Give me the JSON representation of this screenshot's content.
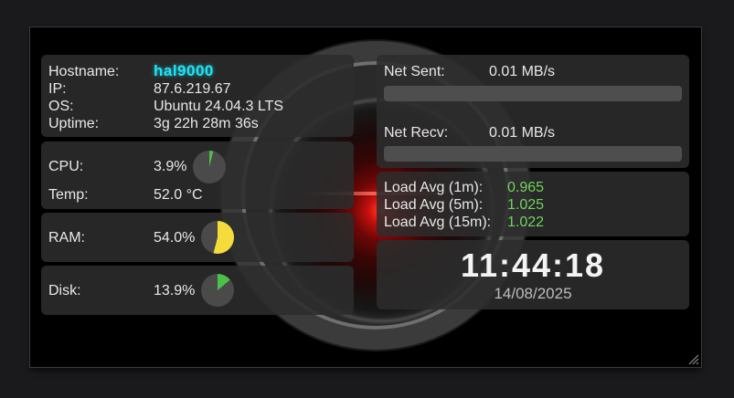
{
  "system": {
    "hostname_label": "Hostname:",
    "hostname": "hal9000",
    "ip_label": "IP:",
    "ip": "87.6.219.67",
    "os_label": "OS:",
    "os": "Ubuntu 24.04.3 LTS",
    "uptime_label": "Uptime:",
    "uptime": "3g 22h 28m 36s"
  },
  "cpu": {
    "label": "CPU:",
    "value": "3.9%",
    "percent": 3.9,
    "color": "#4cc048"
  },
  "temp": {
    "label": "Temp:",
    "value": "52.0 °C"
  },
  "ram": {
    "label": "RAM:",
    "value": "54.0%",
    "percent": 54.0,
    "color": "#f5dc3c"
  },
  "disk": {
    "label": "Disk:",
    "value": "13.9%",
    "percent": 13.9,
    "color": "#4cc048"
  },
  "network": {
    "sent_label": "Net Sent:",
    "sent": "0.01 MB/s",
    "sent_percent": 0,
    "recv_label": "Net Recv:",
    "recv": "0.01 MB/s",
    "recv_percent": 0
  },
  "load": {
    "l1_label": "Load Avg (1m):",
    "l1": "0.965",
    "l5_label": "Load Avg (5m):",
    "l5": "1.025",
    "l15_label": "Load Avg (15m):",
    "l15": "1.022",
    "value_color": "#6fd45c"
  },
  "clock": {
    "time": "11:44:18",
    "date": "14/08/2025"
  },
  "colors": {
    "pie_track": "#4a4a4a",
    "hostname": "#20e4f5"
  }
}
